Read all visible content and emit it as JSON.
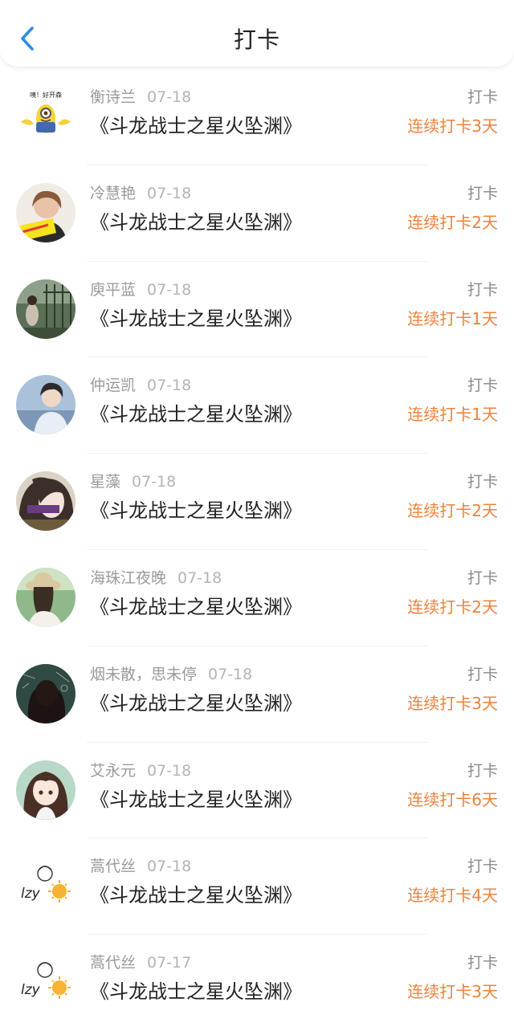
{
  "header": {
    "title": "打卡",
    "back_icon": "chevron-left-icon",
    "accent_color": "#2e8ee0"
  },
  "entries": [
    {
      "name": "衡诗兰",
      "date": "07-18",
      "book": "《斗龙战士之星火坠渊》",
      "action": "打卡",
      "streak": "连续打卡3天",
      "avatar_badge": "咦！好开森"
    },
    {
      "name": "冷慧艳",
      "date": "07-18",
      "book": "《斗龙战士之星火坠渊》",
      "action": "打卡",
      "streak": "连续打卡2天"
    },
    {
      "name": "庾平蓝",
      "date": "07-18",
      "book": "《斗龙战士之星火坠渊》",
      "action": "打卡",
      "streak": "连续打卡1天"
    },
    {
      "name": "仲运凯",
      "date": "07-18",
      "book": "《斗龙战士之星火坠渊》",
      "action": "打卡",
      "streak": "连续打卡1天"
    },
    {
      "name": "星藻",
      "date": "07-18",
      "book": "《斗龙战士之星火坠渊》",
      "action": "打卡",
      "streak": "连续打卡2天"
    },
    {
      "name": "海珠江夜晚",
      "date": "07-18",
      "book": "《斗龙战士之星火坠渊》",
      "action": "打卡",
      "streak": "连续打卡2天"
    },
    {
      "name": "烟未散，思未停",
      "date": "07-18",
      "book": "《斗龙战士之星火坠渊》",
      "action": "打卡",
      "streak": "连续打卡3天"
    },
    {
      "name": "艾永元",
      "date": "07-18",
      "book": "《斗龙战士之星火坠渊》",
      "action": "打卡",
      "streak": "连续打卡6天"
    },
    {
      "name": "蒿代丝",
      "date": "07-18",
      "book": "《斗龙战士之星火坠渊》",
      "action": "打卡",
      "streak": "连续打卡4天",
      "avatar_badge": "lzy"
    },
    {
      "name": "蒿代丝",
      "date": "07-17",
      "book": "《斗龙战士之星火坠渊》",
      "action": "打卡",
      "streak": "连续打卡3天",
      "avatar_badge": "lzy"
    }
  ],
  "colors": {
    "streak": "#f0813a",
    "name": "#9a9a9a",
    "date": "#b4b4b4",
    "book": "#222222"
  }
}
